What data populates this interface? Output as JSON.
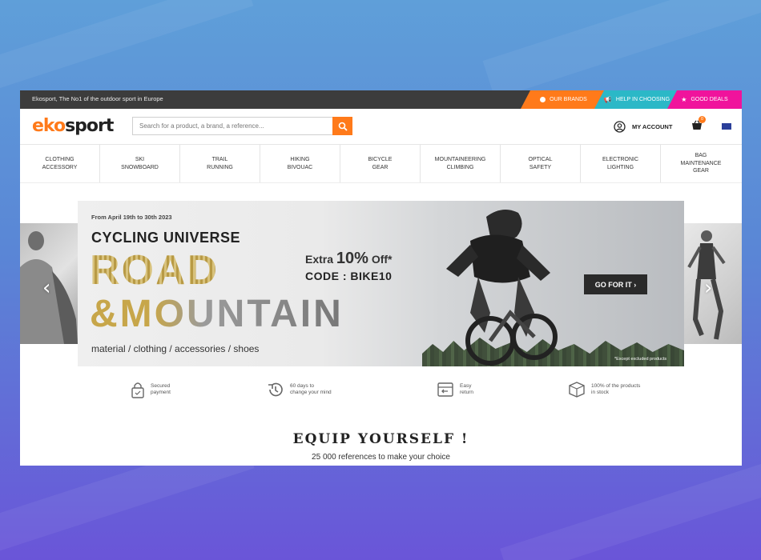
{
  "topbar": {
    "tagline": "Ekosport, The No1 of the outdoor sport in Europe",
    "our_brands": "OUR BRANDS",
    "help_choosing": "HELP IN CHOOSING",
    "good_deals": "GOOD DEALS"
  },
  "header": {
    "logo_eko": "eko",
    "logo_sport": "sport",
    "search_placeholder": "Search for a product, a brand, a reference...",
    "my_account": "MY ACCOUNT",
    "cart_count": "0"
  },
  "nav": [
    "CLOTHING\nACCESSORY",
    "SKI\nSNOWBOARD",
    "TRAIL\nRUNNING",
    "HIKING\nBIVOUAC",
    "BICYCLE\nGEAR",
    "MOUNTAINEERING\nCLIMBING",
    "OPTICAL\nSAFETY",
    "ELECTRONIC\nLIGHTING",
    "BAG\nMAINTENANCE\nGEAR"
  ],
  "banner": {
    "date": "From April 19th to 30th 2023",
    "headline": "CYCLING UNIVERSE",
    "road": "ROAD",
    "mountain": "&MOUNTAIN",
    "subline": "material / clothing / accessories / shoes",
    "offer_prefix": "Extra ",
    "offer_big": "10%",
    "offer_suffix": " Off*",
    "code": "CODE : BIKE10",
    "cta": "GO FOR IT ›",
    "disclaimer": "*Except excluded products"
  },
  "reassurance": [
    {
      "icon": "lock-icon",
      "text": "Secured\npayment"
    },
    {
      "icon": "history-icon",
      "text": "60 days to\nchange your mind"
    },
    {
      "icon": "return-icon",
      "text": "Easy\nreturn"
    },
    {
      "icon": "box-icon",
      "text": "100% of the products\nin stock"
    }
  ],
  "equip": {
    "title": "EQUIP YOURSELF !",
    "subtitle": "25 000 references to make your choice"
  },
  "colors": {
    "brand_orange": "#ff7a1a",
    "help_teal": "#2bb8c7",
    "deals_pink": "#f0139c",
    "topbar_dark": "#3c3c3c"
  }
}
